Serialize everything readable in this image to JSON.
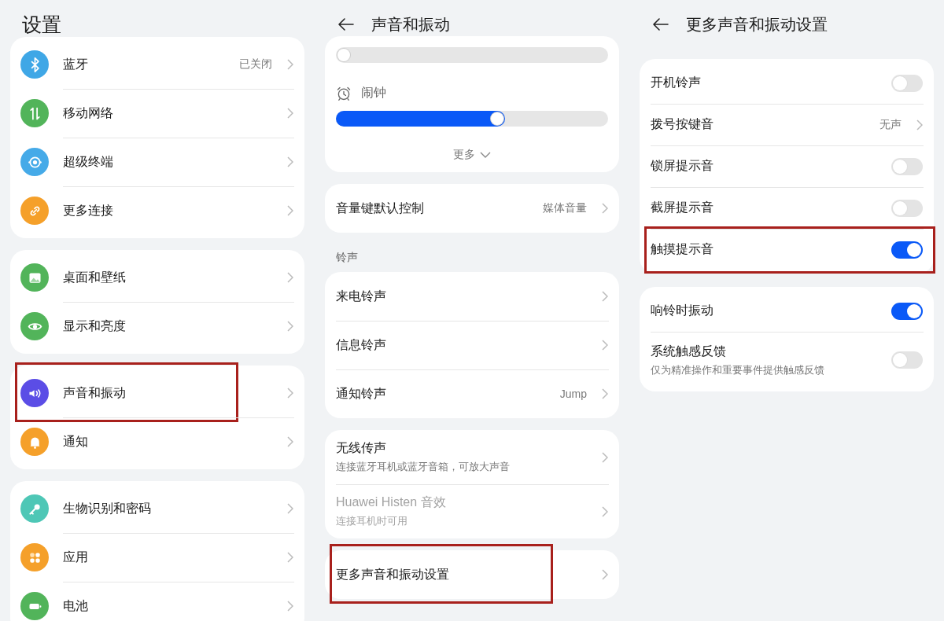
{
  "panels": [
    {
      "title": "设置",
      "back": false,
      "groups": [
        {
          "items": [
            {
              "kind": "nav",
              "color": "#3fa7e6",
              "label": "蓝牙",
              "value": "已关闭",
              "highlighted": false
            },
            {
              "kind": "nav",
              "color": "#52b45a",
              "label": "移动网络",
              "highlighted": false
            },
            {
              "kind": "nav",
              "color": "#45aae8",
              "label": "超级终端",
              "highlighted": false
            },
            {
              "kind": "nav",
              "color": "#f5a02a",
              "label": "更多连接",
              "highlighted": false
            }
          ]
        },
        {
          "items": [
            {
              "kind": "nav",
              "color": "#52b45a",
              "label": "桌面和壁纸",
              "highlighted": false
            },
            {
              "kind": "nav",
              "color": "#52b45a",
              "label": "显示和亮度",
              "highlighted": false
            }
          ]
        },
        {
          "items": [
            {
              "kind": "nav",
              "color": "#5b4de6",
              "label": "声音和振动",
              "highlighted": true
            },
            {
              "kind": "nav",
              "color": "#f5a02a",
              "label": "通知",
              "highlighted": false
            }
          ]
        },
        {
          "items": [
            {
              "kind": "nav",
              "color": "#4ec7b6",
              "label": "生物识别和密码",
              "highlighted": false
            },
            {
              "kind": "nav",
              "color": "#f5a02a",
              "label": "应用",
              "highlighted": false
            },
            {
              "kind": "nav",
              "color": "#52b45a",
              "label": "电池",
              "highlighted": false
            }
          ]
        }
      ]
    },
    {
      "title": "声音和振动",
      "back": true,
      "groups": [
        {
          "items": [
            {
              "kind": "slider"
            },
            {
              "kind": "slider",
              "label": "闹钟",
              "level": 0.62
            },
            {
              "kind": "more",
              "label": "更多"
            }
          ]
        },
        {
          "items": [
            {
              "kind": "nav",
              "label": "音量键默认控制",
              "value": "媒体音量",
              "highlighted": false
            }
          ]
        },
        {
          "label": "铃声",
          "items": [
            {
              "kind": "nav",
              "label": "来电铃声",
              "highlighted": false
            },
            {
              "kind": "nav",
              "label": "信息铃声",
              "highlighted": false
            },
            {
              "kind": "nav",
              "label": "通知铃声",
              "value": "Jump",
              "highlighted": false
            }
          ]
        },
        {
          "items": [
            {
              "kind": "nav",
              "label": "无线传声",
              "subtitle": "连接蓝牙耳机或蓝牙音箱，可放大声音",
              "disabled": false,
              "highlighted": false
            },
            {
              "kind": "nav",
              "label": "Huawei Histen 音效",
              "subtitle": "连接耳机时可用",
              "disabled": true,
              "highlighted": false
            }
          ]
        },
        {
          "items": [
            {
              "kind": "nav",
              "label": "更多声音和振动设置",
              "highlighted": true
            }
          ]
        }
      ]
    },
    {
      "title": "更多声音和振动设置",
      "back": true,
      "groups": [
        {
          "items": [
            {
              "kind": "toggle",
              "label": "开机铃声",
              "on": false,
              "highlighted": false
            },
            {
              "kind": "nav",
              "label": "拨号按键音",
              "value": "无声",
              "highlighted": false
            },
            {
              "kind": "toggle",
              "label": "锁屏提示音",
              "on": false,
              "highlighted": false
            },
            {
              "kind": "toggle",
              "label": "截屏提示音",
              "on": false,
              "highlighted": false
            },
            {
              "kind": "toggle",
              "label": "触摸提示音",
              "on": true,
              "highlighted": true
            }
          ]
        },
        {
          "items": [
            {
              "kind": "toggle",
              "label": "响铃时振动",
              "on": true,
              "highlighted": false
            },
            {
              "kind": "toggle",
              "label": "系统触感反馈",
              "subtitle": "仅为精准操作和重要事件提供触感反馈",
              "on": false,
              "highlighted": false
            }
          ]
        }
      ]
    }
  ]
}
